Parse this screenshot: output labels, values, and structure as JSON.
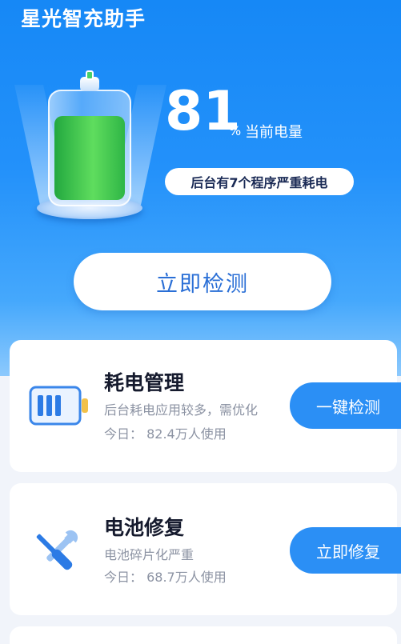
{
  "app": {
    "title": "星光智充助手"
  },
  "battery": {
    "level": 81,
    "percent_value": "81",
    "percent_unit": "%",
    "percent_caption": "当前电量",
    "background_warning": "后台有7个程序严重耗电",
    "fill_color": "#4fd25a"
  },
  "detect_button": {
    "label": "立即检测"
  },
  "cards": [
    {
      "title": "耗电管理",
      "description": "后台耗电应用较多，需优化",
      "users_label": "今日：",
      "users_value": "82.4万人使用",
      "action_label": "一键检测",
      "icon": "battery-icon"
    },
    {
      "title": "电池修复",
      "description": "电池碎片化严重",
      "users_label": "今日：",
      "users_value": "68.7万人使用",
      "action_label": "立即修复",
      "icon": "wrench-screwdriver-icon"
    }
  ],
  "colors": {
    "accent": "#2b8ff5",
    "hero_top": "#1688f6",
    "text_primary": "#151a2d",
    "text_secondary": "#8c93a3"
  }
}
